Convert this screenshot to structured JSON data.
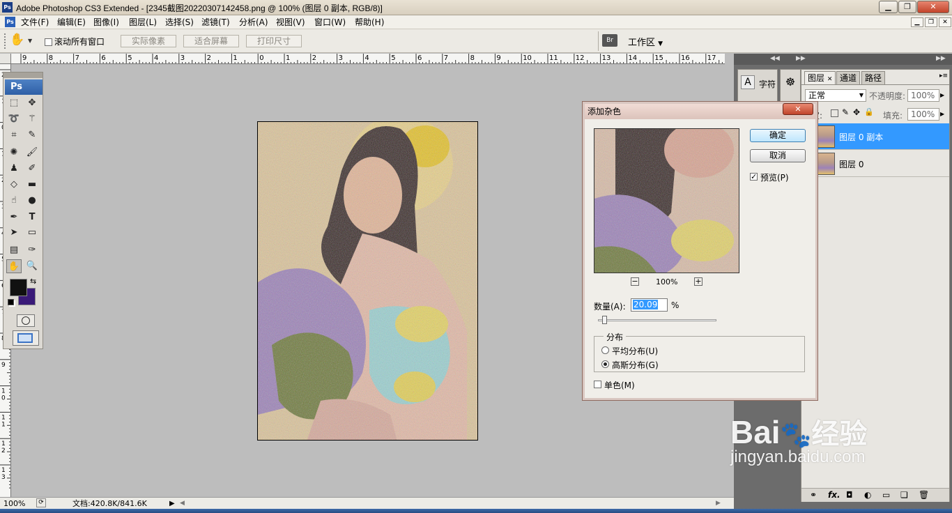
{
  "window": {
    "title": "Adobe Photoshop CS3 Extended - [2345截图20220307142458.png @ 100% (图层 0 副本, RGB/8)]",
    "app_icon": "Ps"
  },
  "menu": {
    "items": [
      "文件(F)",
      "编辑(E)",
      "图像(I)",
      "图层(L)",
      "选择(S)",
      "滤镜(T)",
      "分析(A)",
      "视图(V)",
      "窗口(W)",
      "帮助(H)"
    ]
  },
  "options": {
    "scroll_all_label": "滚动所有窗口",
    "actual_pixels": "实际像素",
    "fit_screen": "适合屏幕",
    "print_size": "打印尺寸",
    "workspace": "工作区"
  },
  "ruler": {
    "top_labels": [
      "9",
      "8",
      "7",
      "6",
      "5",
      "4",
      "3",
      "2",
      "1",
      "0",
      "1",
      "2",
      "3",
      "4",
      "5",
      "6",
      "7",
      "8",
      "9",
      "10",
      "11",
      "12",
      "13",
      "14",
      "15",
      "16",
      "17"
    ],
    "left_labels": [
      "2",
      "1",
      "0",
      "1",
      "2",
      "3",
      "4",
      "5",
      "6",
      "7",
      "8",
      "9",
      "1 0",
      "1 1",
      "1 2",
      "1 3"
    ]
  },
  "toolbox": {
    "logo": "Ps"
  },
  "status": {
    "zoom": "100%",
    "doc": "文档:420.8K/841.6K"
  },
  "panels": {
    "char_label": "字符",
    "tabs": [
      "图层",
      "通道",
      "路径"
    ],
    "blend_mode": "正常",
    "opacity_label": "不透明度:",
    "opacity_value": "100%",
    "lock_label": "锁定:",
    "fill_label": "填充:",
    "fill_value": "100%",
    "layers": [
      {
        "name": "图层 0 副本",
        "selected": true
      },
      {
        "name": "图层 0",
        "selected": false
      }
    ]
  },
  "dialog": {
    "title": "添加杂色",
    "ok": "确定",
    "cancel": "取消",
    "preview_label": "预览(P)",
    "zoom": "100%",
    "amount_label": "数量(A):",
    "amount_value": "20.09",
    "amount_unit": "%",
    "amount_fraction": 0.05,
    "distribution_label": "分布",
    "uniform": "平均分布(U)",
    "gaussian": "高斯分布(G)",
    "mono": "单色(M)",
    "preview_checked": true,
    "gaussian_selected": true,
    "mono_checked": false
  },
  "watermark": {
    "brand": "Bai",
    "brand_cn": "经验",
    "url": "jingyan.baidu.com"
  },
  "colors": {
    "foreground": "#111111",
    "background": "#3a1a78",
    "selection": "#3399ff",
    "layer_selected": "#3399ff"
  }
}
